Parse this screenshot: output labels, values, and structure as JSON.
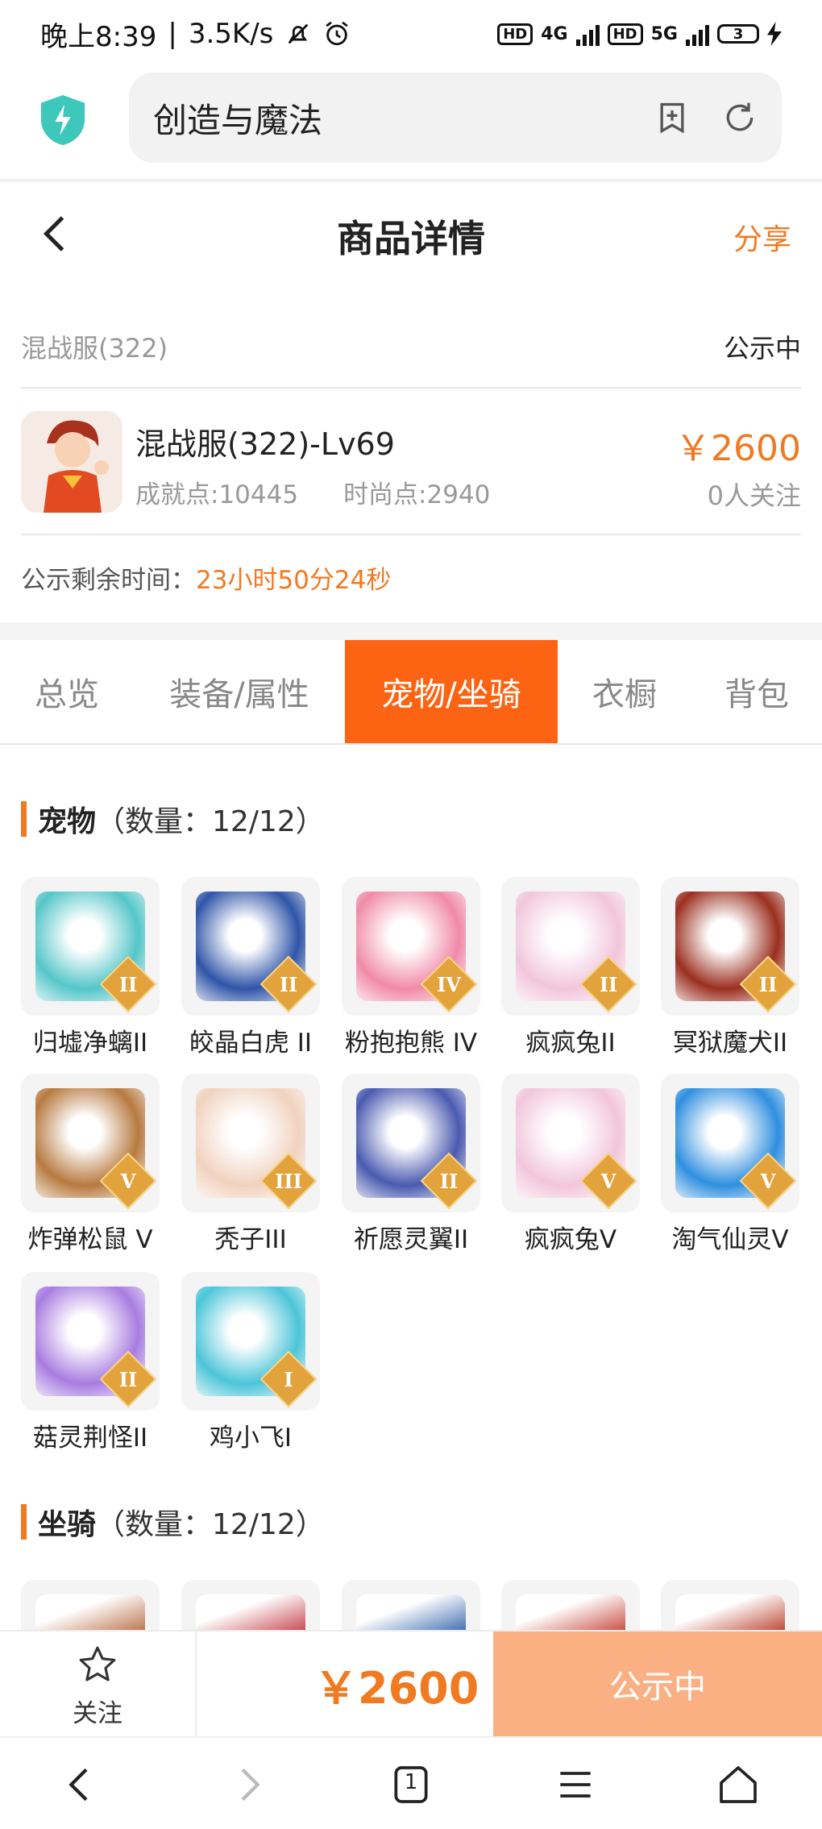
{
  "status_bar": {
    "time": "晚上8:39",
    "speed": "3.5K/s",
    "hd1": "HD",
    "net1": "4G",
    "hd2": "HD",
    "net2": "5G",
    "battery": "3"
  },
  "browser": {
    "url_text": "创造与魔法"
  },
  "header": {
    "title": "商品详情",
    "share": "分享"
  },
  "server": {
    "name": "混战服(322)",
    "status": "公示中"
  },
  "character": {
    "name": "混战服(322)-Lv69",
    "achievement": "成就点:10445",
    "fashion": "时尚点:2940",
    "price": "￥2600",
    "watchers": "0人关注"
  },
  "remaining": {
    "label": "公示剩余时间：",
    "time": "23小时50分24秒"
  },
  "tabs": [
    {
      "label": "总览"
    },
    {
      "label": "装备/属性"
    },
    {
      "label": "宠物/坐骑",
      "active": true
    },
    {
      "label": "衣橱"
    },
    {
      "label": "背包"
    }
  ],
  "pets_section": {
    "title": "宠物",
    "count": "（数量：12/12）",
    "items": [
      {
        "name": "归墟净螭II",
        "grade": "II",
        "icon": "dragon-icon",
        "color": "#55c6c9"
      },
      {
        "name": "皎晶白虎 II",
        "grade": "II",
        "icon": "tiger-icon",
        "color": "#2f55a8"
      },
      {
        "name": "粉抱抱熊 IV",
        "grade": "IV",
        "icon": "bear-icon",
        "color": "#f08aa8"
      },
      {
        "name": "疯疯兔II",
        "grade": "II",
        "icon": "rabbit-icon",
        "color": "#f2c6dc"
      },
      {
        "name": "冥狱魔犬II",
        "grade": "II",
        "icon": "hellhound-icon",
        "color": "#9b2f1f"
      },
      {
        "name": "炸弹松鼠 V",
        "grade": "V",
        "icon": "squirrel-icon",
        "color": "#b77a3f"
      },
      {
        "name": "秃子III",
        "grade": "III",
        "icon": "bald-head-icon",
        "color": "#f1d2bf"
      },
      {
        "name": "祈愿灵翼II",
        "grade": "II",
        "icon": "eagle-icon",
        "color": "#4a5ab0"
      },
      {
        "name": "疯疯兔V",
        "grade": "V",
        "icon": "rabbit-icon",
        "color": "#f2c6dc"
      },
      {
        "name": "淘气仙灵V",
        "grade": "V",
        "icon": "pup-icon",
        "color": "#2f8fe0"
      },
      {
        "name": "菇灵荆怪II",
        "grade": "II",
        "icon": "mushroom-sprite-icon",
        "color": "#a87ce0"
      },
      {
        "name": "鸡小飞I",
        "grade": "I",
        "icon": "chick-icon",
        "color": "#4cc5d8"
      }
    ]
  },
  "mounts_section": {
    "title": "坐骑",
    "count": "（数量：12/12）",
    "items": [
      {
        "icon": "mount-icon",
        "color": "#b5653a"
      },
      {
        "icon": "mount-icon",
        "color": "#c2343f"
      },
      {
        "icon": "mount-icon",
        "color": "#2b5fa8"
      },
      {
        "icon": "mount-icon",
        "color": "#c33a2e"
      },
      {
        "icon": "mount-icon",
        "color": "#b8341f"
      }
    ]
  },
  "bottom_bar": {
    "follow_label": "关注",
    "price": "￥2600",
    "status_button": "公示中"
  },
  "system_nav": {
    "tab_count": "1"
  },
  "colors": {
    "accent": "#f07a22",
    "active_tab": "#fc6414",
    "status_button": "#fbb084"
  }
}
